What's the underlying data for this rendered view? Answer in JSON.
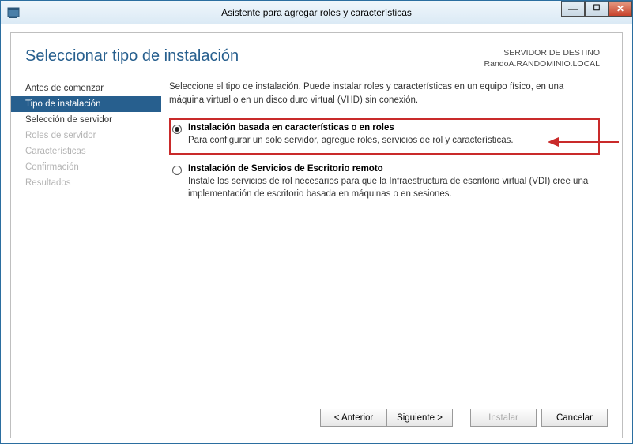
{
  "window": {
    "title": "Asistente para agregar roles y características"
  },
  "header": {
    "page_title": "Seleccionar tipo de instalación",
    "dest_label": "SERVIDOR DE DESTINO",
    "dest_value": "RandoA.RANDOMINIO.LOCAL"
  },
  "nav": {
    "items": [
      {
        "label": "Antes de comenzar",
        "state": "normal"
      },
      {
        "label": "Tipo de instalación",
        "state": "active"
      },
      {
        "label": "Selección de servidor",
        "state": "normal"
      },
      {
        "label": "Roles de servidor",
        "state": "dim"
      },
      {
        "label": "Características",
        "state": "dim"
      },
      {
        "label": "Confirmación",
        "state": "dim"
      },
      {
        "label": "Resultados",
        "state": "dim"
      }
    ]
  },
  "main": {
    "intro": "Seleccione el tipo de instalación. Puede instalar roles y características en un equipo físico, en una máquina virtual o en un disco duro virtual (VHD) sin conexión.",
    "options": [
      {
        "title": "Instalación basada en características o en roles",
        "desc": "Para configurar un solo servidor, agregue roles, servicios de rol y características.",
        "selected": true,
        "highlighted": true
      },
      {
        "title": "Instalación de Servicios de Escritorio remoto",
        "desc": "Instale los servicios de rol necesarios para que la Infraestructura de escritorio virtual (VDI) cree una implementación de escritorio basada en máquinas o en sesiones.",
        "selected": false,
        "highlighted": false
      }
    ]
  },
  "buttons": {
    "prev": "< Anterior",
    "next": "Siguiente >",
    "install": "Instalar",
    "cancel": "Cancelar"
  }
}
